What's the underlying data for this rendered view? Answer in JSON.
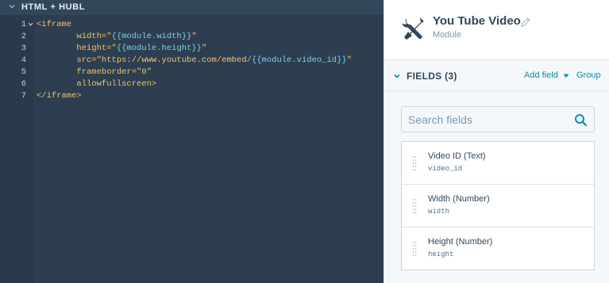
{
  "editor": {
    "section_label": "HTML + HUBL",
    "line_numbers": [
      "1",
      "2",
      "3",
      "4",
      "5",
      "6",
      "7"
    ],
    "lines": [
      [
        {
          "t": "<iframe",
          "c": "tag"
        }
      ],
      [
        {
          "t": "        width=\"",
          "c": "attr"
        },
        {
          "t": "{{module.width}}",
          "c": "var"
        },
        {
          "t": "\"",
          "c": "str"
        }
      ],
      [
        {
          "t": "        height=\"",
          "c": "attr"
        },
        {
          "t": "{{module.height}}",
          "c": "var"
        },
        {
          "t": "\"",
          "c": "str"
        }
      ],
      [
        {
          "t": "        src=\"https://www.youtube.com/embed/",
          "c": "attr"
        },
        {
          "t": "{{module.video_id}}",
          "c": "var"
        },
        {
          "t": "\"",
          "c": "str"
        }
      ],
      [
        {
          "t": "        frameborder=\"0\"",
          "c": "attr"
        }
      ],
      [
        {
          "t": "        allowfullscreen>",
          "c": "attr"
        }
      ],
      [
        {
          "t": "</iframe>",
          "c": "tag"
        }
      ]
    ]
  },
  "module": {
    "title": "You Tube Video",
    "subtitle": "Module",
    "icon": "tools-icon"
  },
  "fields_section": {
    "title": "FIELDS (3)",
    "add_field_label": "Add field",
    "group_label": "Group",
    "search_placeholder": "Search fields",
    "items": [
      {
        "label": "Video ID (Text)",
        "key": "video_id"
      },
      {
        "label": "Width (Number)",
        "key": "width"
      },
      {
        "label": "Height (Number)",
        "key": "height"
      }
    ]
  },
  "colors": {
    "editor_bg": "#2c3e50",
    "code_text": "#f5c26b",
    "code_variable": "#7fd1e8",
    "link": "#0091ae",
    "heading": "#33475b"
  }
}
